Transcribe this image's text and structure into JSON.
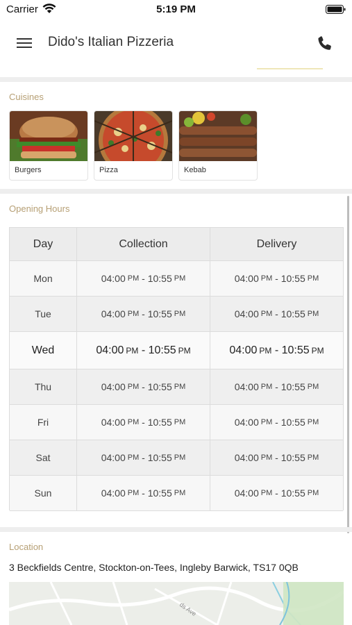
{
  "status_bar": {
    "carrier": "Carrier",
    "time": "5:19 PM"
  },
  "header": {
    "title": "Dido's Italian Pizzeria"
  },
  "cuisines": {
    "label": "Cuisines",
    "items": [
      {
        "name": "Burgers",
        "icon": "burger-photo"
      },
      {
        "name": "Pizza",
        "icon": "pizza-photo"
      },
      {
        "name": "Kebab",
        "icon": "kebab-photo"
      }
    ]
  },
  "opening_hours": {
    "label": "Opening Hours",
    "headers": {
      "day": "Day",
      "collection": "Collection",
      "delivery": "Delivery"
    },
    "rows": [
      {
        "day": "Mon",
        "collection": {
          "open": "04:00",
          "open_ampm": "PM",
          "close": "10:55",
          "close_ampm": "PM"
        },
        "delivery": {
          "open": "04:00",
          "open_ampm": "PM",
          "close": "10:55",
          "close_ampm": "PM"
        }
      },
      {
        "day": "Tue",
        "collection": {
          "open": "04:00",
          "open_ampm": "PM",
          "close": "10:55",
          "close_ampm": "PM"
        },
        "delivery": {
          "open": "04:00",
          "open_ampm": "PM",
          "close": "10:55",
          "close_ampm": "PM"
        }
      },
      {
        "day": "Wed",
        "collection": {
          "open": "04:00",
          "open_ampm": "PM",
          "close": "10:55",
          "close_ampm": "PM"
        },
        "delivery": {
          "open": "04:00",
          "open_ampm": "PM",
          "close": "10:55",
          "close_ampm": "PM"
        }
      },
      {
        "day": "Thu",
        "collection": {
          "open": "04:00",
          "open_ampm": "PM",
          "close": "10:55",
          "close_ampm": "PM"
        },
        "delivery": {
          "open": "04:00",
          "open_ampm": "PM",
          "close": "10:55",
          "close_ampm": "PM"
        }
      },
      {
        "day": "Fri",
        "collection": {
          "open": "04:00",
          "open_ampm": "PM",
          "close": "10:55",
          "close_ampm": "PM"
        },
        "delivery": {
          "open": "04:00",
          "open_ampm": "PM",
          "close": "10:55",
          "close_ampm": "PM"
        }
      },
      {
        "day": "Sat",
        "collection": {
          "open": "04:00",
          "open_ampm": "PM",
          "close": "10:55",
          "close_ampm": "PM"
        },
        "delivery": {
          "open": "04:00",
          "open_ampm": "PM",
          "close": "10:55",
          "close_ampm": "PM"
        }
      },
      {
        "day": "Sun",
        "collection": {
          "open": "04:00",
          "open_ampm": "PM",
          "close": "10:55",
          "close_ampm": "PM"
        },
        "delivery": {
          "open": "04:00",
          "open_ampm": "PM",
          "close": "10:55",
          "close_ampm": "PM"
        }
      }
    ]
  },
  "location": {
    "label": "Location",
    "address": "3 Beckfields Centre, Stockton-on-Tees, Ingleby Barwick, TS17 0QB",
    "map_street_label": "ds Ave"
  },
  "colors": {
    "section_label": "#b69f74",
    "row_odd": "#f7f7f7",
    "row_even": "#efefef",
    "today_row": "#fafafa",
    "header_row": "#ececec"
  }
}
